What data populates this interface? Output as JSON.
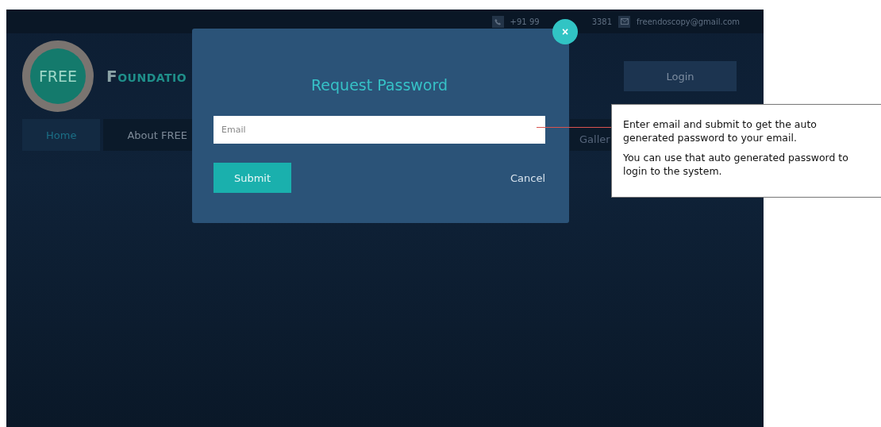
{
  "top_bar": {
    "phone_start": "+91 99",
    "phone_end": "3381",
    "email": "freendoscopy@gmail.com"
  },
  "header": {
    "logo_text": "FREE",
    "title_initial": "F",
    "title_rest": "OUNDATIO",
    "login_button": "Login"
  },
  "nav": {
    "items": [
      {
        "label": "Home",
        "selected": true
      },
      {
        "label": "About FREE",
        "selected": false
      }
    ],
    "cut_item": "Galler"
  },
  "modal": {
    "title": "Request Password",
    "email_placeholder": "Email",
    "submit": "Submit",
    "cancel": "Cancel",
    "close": "×"
  },
  "callout": {
    "paragraphs": [
      "Enter email and submit to get the auto generated password to your email.",
      "You can use that auto generated password to login to the system."
    ]
  }
}
